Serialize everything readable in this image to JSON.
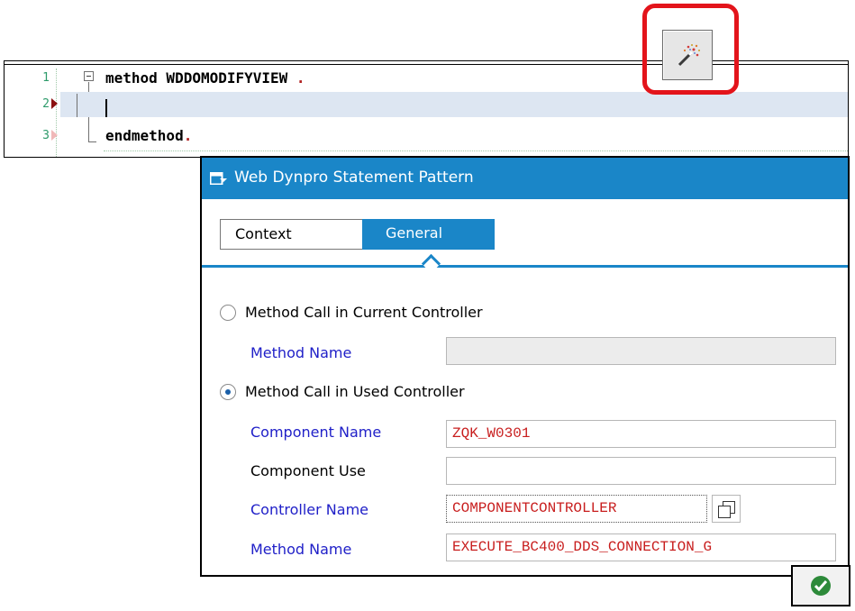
{
  "editor": {
    "lines": [
      {
        "number": "1",
        "keyword": "method",
        "text": " WDDOMODIFYVIEW ",
        "dot": "."
      },
      {
        "number": "2",
        "keyword": "",
        "text": "",
        "dot": ""
      },
      {
        "number": "3",
        "keyword": "endmethod",
        "text": "",
        "dot": "."
      }
    ]
  },
  "toolbar": {
    "pattern_button_icon": "magic-wand-icon"
  },
  "dialog": {
    "title": "Web Dynpro Statement Pattern",
    "tabs": [
      {
        "label": "Context"
      },
      {
        "label": "General"
      }
    ],
    "option_current": {
      "label": "Method Call in Current Controller",
      "method_name_label": "Method Name",
      "method_name_value": ""
    },
    "option_used": {
      "label": "Method Call in Used Controller",
      "component_name_label": "Component Name",
      "component_name_value": "ZQK_W0301",
      "component_use_label": "Component Use",
      "component_use_value": "",
      "controller_name_label": "Controller Name",
      "controller_name_value": "COMPONENTCONTROLLER",
      "method_name_label": "Method Name",
      "method_name_value": "EXECUTE_BC400_DDS_CONNECTION_G"
    },
    "selected_option": "used"
  },
  "confirm_button": {
    "icon": "checkmark-icon"
  },
  "colors": {
    "accent": "#1a86c8",
    "highlight_frame": "#e3141b",
    "required_label": "#2020c8",
    "value_text": "#c81e1e"
  }
}
